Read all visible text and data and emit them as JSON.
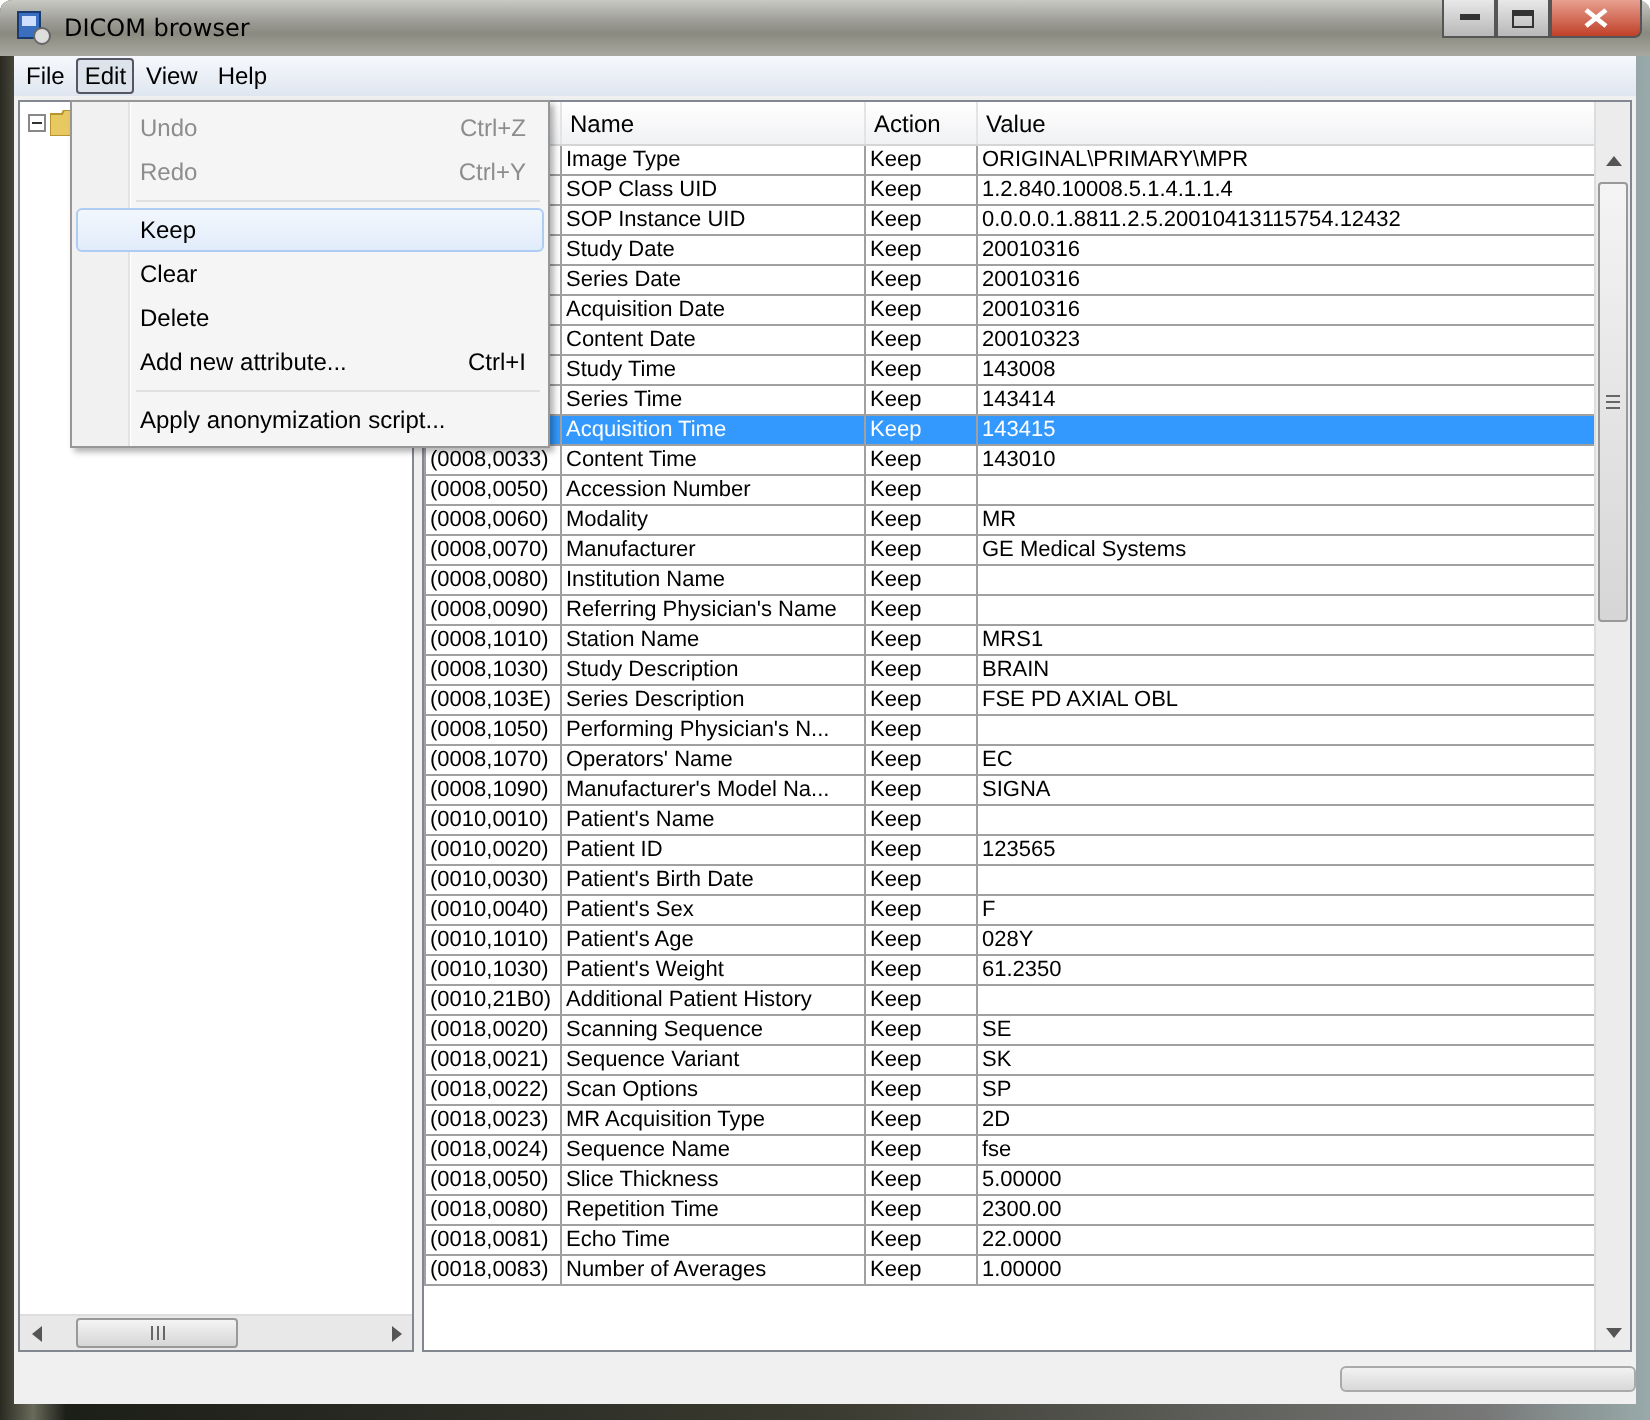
{
  "window": {
    "title": "DICOM browser"
  },
  "menu_bar": [
    {
      "label": "File",
      "selected": false
    },
    {
      "label": "Edit",
      "selected": true
    },
    {
      "label": "View",
      "selected": false
    },
    {
      "label": "Help",
      "selected": false
    }
  ],
  "edit_menu": [
    {
      "kind": "item",
      "label": "Undo",
      "shortcut": "Ctrl+Z",
      "disabled": true,
      "selected": false
    },
    {
      "kind": "item",
      "label": "Redo",
      "shortcut": "Ctrl+Y",
      "disabled": true,
      "selected": false
    },
    {
      "kind": "separator"
    },
    {
      "kind": "item",
      "label": "Keep",
      "disabled": false,
      "selected": true
    },
    {
      "kind": "item",
      "label": "Clear",
      "disabled": false,
      "selected": false
    },
    {
      "kind": "item",
      "label": "Delete",
      "disabled": false,
      "selected": false
    },
    {
      "kind": "item",
      "label": "Add new attribute...",
      "shortcut": "Ctrl+I",
      "disabled": false,
      "selected": false
    },
    {
      "kind": "separator"
    },
    {
      "kind": "item",
      "label": "Apply anonymization script...",
      "disabled": false,
      "selected": false
    }
  ],
  "tree": {
    "expanded": true
  },
  "progress": {
    "level": 0
  },
  "table": {
    "columns": [
      "Name",
      "Action",
      "Value"
    ],
    "rows": [
      {
        "name": "Image Type",
        "action": "Keep",
        "value": "ORIGINAL\\PRIMARY\\MPR",
        "selected": false
      },
      {
        "name": "SOP Class UID",
        "action": "Keep",
        "value": "1.2.840.10008.5.1.4.1.1.4",
        "selected": false
      },
      {
        "name": "SOP Instance UID",
        "action": "Keep",
        "value": "0.0.0.0.1.8811.2.5.20010413115754.12432",
        "selected": false
      },
      {
        "name": "Study Date",
        "action": "Keep",
        "value": "20010316",
        "selected": false
      },
      {
        "name": "Series Date",
        "action": "Keep",
        "value": "20010316",
        "selected": false
      },
      {
        "name": "Acquisition Date",
        "action": "Keep",
        "value": "20010316",
        "selected": false
      },
      {
        "name": "Content Date",
        "action": "Keep",
        "value": "20010323",
        "selected": false
      },
      {
        "name": "Study Time",
        "action": "Keep",
        "value": "143008",
        "selected": false
      },
      {
        "name": "Series Time",
        "action": "Keep",
        "value": "143414",
        "selected": false
      },
      {
        "name": "Acquisition Time",
        "action": "Keep",
        "value": "143415",
        "selected": true
      },
      {
        "tag": "(0008,0033)",
        "name": "Content Time",
        "action": "Keep",
        "value": "143010",
        "selected": false
      },
      {
        "tag": "(0008,0050)",
        "name": "Accession Number",
        "action": "Keep",
        "selected": false
      },
      {
        "tag": "(0008,0060)",
        "name": "Modality",
        "action": "Keep",
        "value": "MR",
        "selected": false
      },
      {
        "tag": "(0008,0070)",
        "name": "Manufacturer",
        "action": "Keep",
        "value": "GE Medical Systems",
        "selected": false
      },
      {
        "tag": "(0008,0080)",
        "name": "Institution Name",
        "action": "Keep",
        "selected": false
      },
      {
        "tag": "(0008,0090)",
        "name": "Referring Physician's Name",
        "action": "Keep",
        "selected": false
      },
      {
        "tag": "(0008,1010)",
        "name": "Station Name",
        "action": "Keep",
        "value": "MRS1",
        "selected": false
      },
      {
        "tag": "(0008,1030)",
        "name": "Study Description",
        "action": "Keep",
        "value": "BRAIN",
        "selected": false
      },
      {
        "tag": "(0008,103E)",
        "name": "Series Description",
        "action": "Keep",
        "value": "FSE PD AXIAL OBL",
        "selected": false
      },
      {
        "tag": "(0008,1050)",
        "name": "Performing Physician's N...",
        "action": "Keep",
        "selected": false
      },
      {
        "tag": "(0008,1070)",
        "name": "Operators' Name",
        "action": "Keep",
        "value": "EC",
        "selected": false
      },
      {
        "tag": "(0008,1090)",
        "name": "Manufacturer's Model Na...",
        "action": "Keep",
        "value": "SIGNA",
        "selected": false
      },
      {
        "tag": "(0010,0010)",
        "name": "Patient's Name",
        "action": "Keep",
        "selected": false
      },
      {
        "tag": "(0010,0020)",
        "name": "Patient ID",
        "action": "Keep",
        "value": "123565",
        "selected": false
      },
      {
        "tag": "(0010,0030)",
        "name": "Patient's Birth Date",
        "action": "Keep",
        "selected": false
      },
      {
        "tag": "(0010,0040)",
        "name": "Patient's Sex",
        "action": "Keep",
        "value": "F",
        "selected": false
      },
      {
        "tag": "(0010,1010)",
        "name": "Patient's Age",
        "action": "Keep",
        "value": "028Y",
        "selected": false
      },
      {
        "tag": "(0010,1030)",
        "name": "Patient's Weight",
        "action": "Keep",
        "value": "61.2350",
        "selected": false
      },
      {
        "tag": "(0010,21B0)",
        "name": "Additional Patient History",
        "action": "Keep",
        "selected": false
      },
      {
        "tag": "(0018,0020)",
        "name": "Scanning Sequence",
        "action": "Keep",
        "value": "SE",
        "selected": false
      },
      {
        "tag": "(0018,0021)",
        "name": "Sequence Variant",
        "action": "Keep",
        "value": "SK",
        "selected": false
      },
      {
        "tag": "(0018,0022)",
        "name": "Scan Options",
        "action": "Keep",
        "value": "SP",
        "selected": false
      },
      {
        "tag": "(0018,0023)",
        "name": "MR Acquisition Type",
        "action": "Keep",
        "value": "2D",
        "selected": false
      },
      {
        "tag": "(0018,0024)",
        "name": "Sequence Name",
        "action": "Keep",
        "value": "fse",
        "selected": false
      },
      {
        "tag": "(0018,0050)",
        "name": "Slice Thickness",
        "action": "Keep",
        "value": "5.00000",
        "selected": false
      },
      {
        "tag": "(0018,0080)",
        "name": "Repetition Time",
        "action": "Keep",
        "value": "2300.00",
        "selected": false
      },
      {
        "tag": "(0018,0081)",
        "name": "Echo Time",
        "action": "Keep",
        "value": "22.0000",
        "selected": false
      },
      {
        "tag": "(0018,0083)",
        "name": "Number of Averages",
        "action": "Keep",
        "value": "1.00000",
        "selected": false
      }
    ]
  }
}
